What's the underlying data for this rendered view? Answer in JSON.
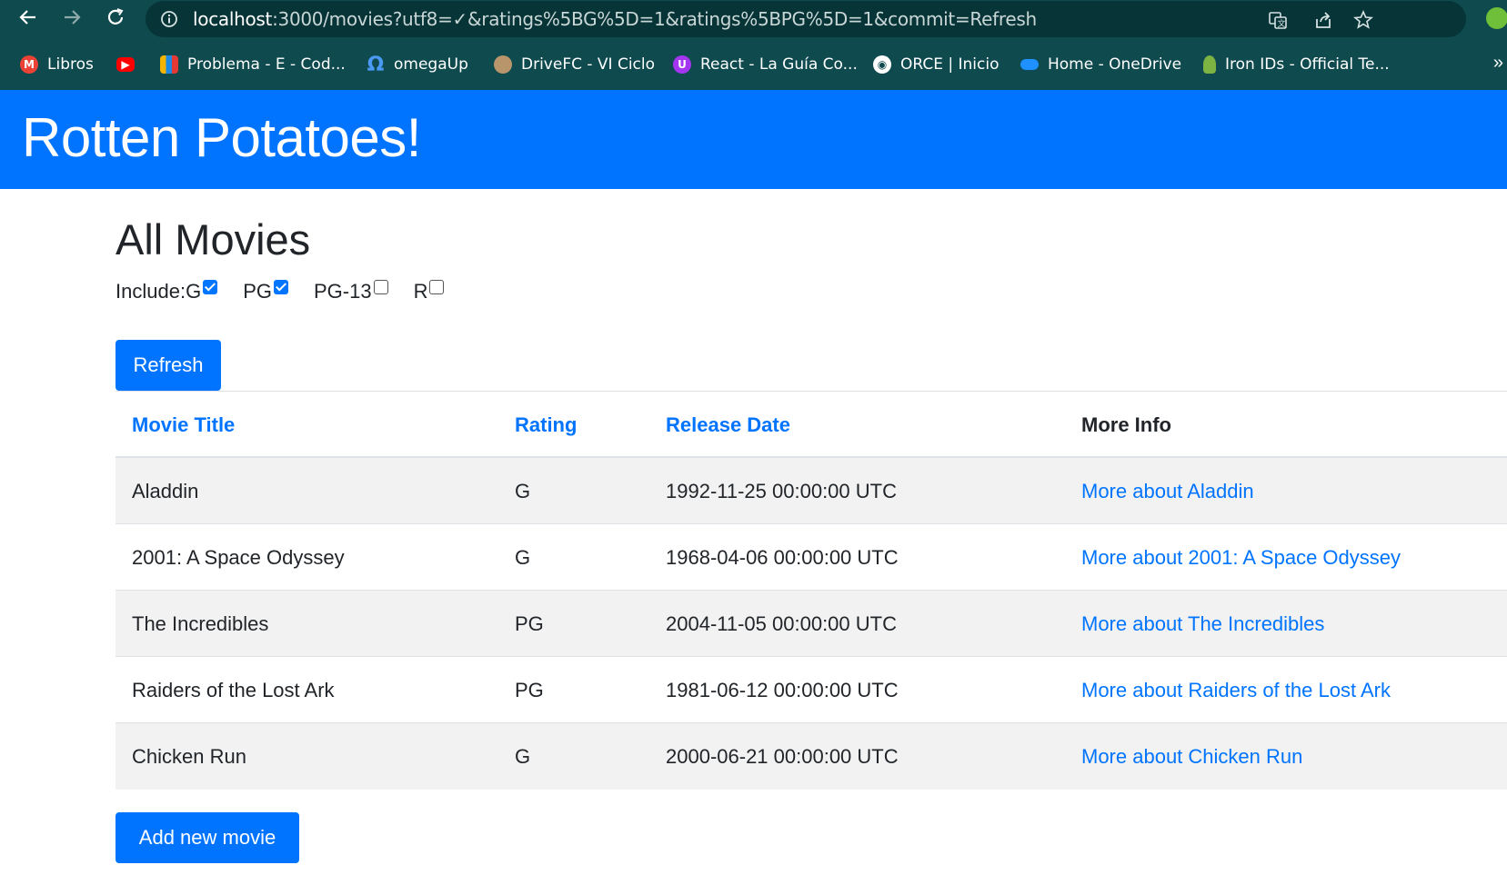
{
  "browser": {
    "url_host": "localhost",
    "url_rest": ":3000/movies?utf8=✓&ratings%5BG%5D=1&ratings%5BPG%5D=1&commit=Refresh",
    "bookmarks": [
      {
        "label": "Libros",
        "icon": "gmail-icon",
        "color": "#ea4335"
      },
      {
        "label": "",
        "icon": "youtube-icon",
        "color": "#ff0000"
      },
      {
        "label": "Problema - E - Cod...",
        "icon": "codeforces-icon",
        "color": "#1e88e5"
      },
      {
        "label": "omegaUp",
        "icon": "omega-icon",
        "color": "#1976d2"
      },
      {
        "label": "DriveFC - VI Ciclo",
        "icon": "drivefc-icon",
        "color": "#b8956a"
      },
      {
        "label": "React - La Guía Co...",
        "icon": "udemy-icon",
        "color": "#a435f0"
      },
      {
        "label": "ORCE | Inicio",
        "icon": "globe-icon",
        "color": "#ffffff"
      },
      {
        "label": "Home - OneDrive",
        "icon": "onedrive-icon",
        "color": "#1e90ff"
      },
      {
        "label": "Iron IDs - Official Te...",
        "icon": "ironids-icon",
        "color": "#7cb342"
      }
    ]
  },
  "header": {
    "brand": "Rotten Potatoes!"
  },
  "main": {
    "title": "All Movies",
    "filter_label": "Include: ",
    "ratings": [
      {
        "label": "G",
        "checked": true
      },
      {
        "label": "PG",
        "checked": true
      },
      {
        "label": "PG-13",
        "checked": false
      },
      {
        "label": "R",
        "checked": false
      }
    ],
    "refresh_label": "Refresh",
    "add_label": "Add new movie",
    "columns": [
      "Movie Title",
      "Rating",
      "Release Date",
      "More Info"
    ],
    "movies": [
      {
        "title": "Aladdin",
        "rating": "G",
        "release": "1992-11-25 00:00:00 UTC",
        "more": "More about Aladdin"
      },
      {
        "title": "2001: A Space Odyssey",
        "rating": "G",
        "release": "1968-04-06 00:00:00 UTC",
        "more": "More about 2001: A Space Odyssey"
      },
      {
        "title": "The Incredibles",
        "rating": "PG",
        "release": "2004-11-05 00:00:00 UTC",
        "more": "More about The Incredibles"
      },
      {
        "title": "Raiders of the Lost Ark",
        "rating": "PG",
        "release": "1981-06-12 00:00:00 UTC",
        "more": "More about Raiders of the Lost Ark"
      },
      {
        "title": "Chicken Run",
        "rating": "G",
        "release": "2000-06-21 00:00:00 UTC",
        "more": "More about Chicken Run"
      }
    ]
  }
}
